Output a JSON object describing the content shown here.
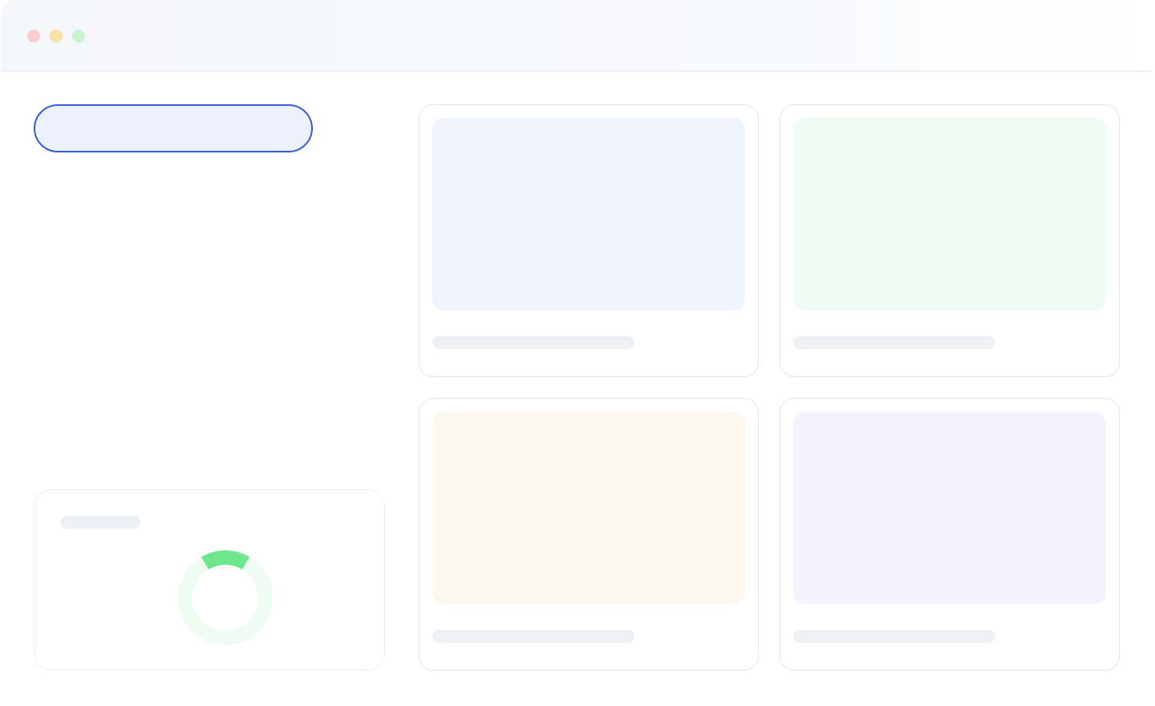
{
  "window": {
    "controls": [
      "close",
      "minimize",
      "maximize"
    ],
    "colors": {
      "close": "#fccccc",
      "minimize": "#fde1a3",
      "maximize": "#c9f2d3"
    }
  },
  "search_pill": {
    "border_color": "#3a5bd7",
    "fill_color": "#edf0fd"
  },
  "cards": [
    {
      "name": "card-1",
      "thumb_color": "#edf4fe"
    },
    {
      "name": "card-2",
      "thumb_color": "#effcf3"
    },
    {
      "name": "card-3",
      "thumb_color": "#fdf8ee"
    },
    {
      "name": "card-4",
      "thumb_color": "#f4f3fe"
    }
  ],
  "progress_ring": {
    "value": 0.17,
    "track_color": "#eefcf2",
    "fill_color": "#6ee78c"
  }
}
